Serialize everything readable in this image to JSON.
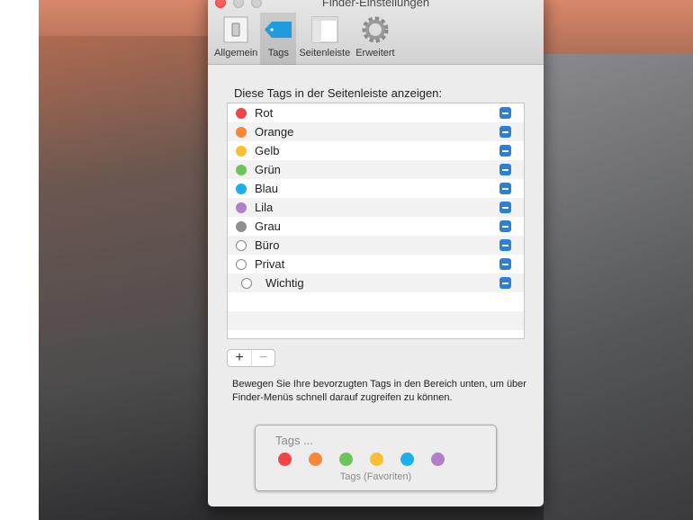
{
  "window": {
    "title": "Finder-Einstellungen"
  },
  "tabs": [
    {
      "label": "Allgemein"
    },
    {
      "label": "Tags",
      "active": true
    },
    {
      "label": "Seitenleiste"
    },
    {
      "label": "Erweitert"
    }
  ],
  "heading": "Diese Tags in der Seitenleiste anzeigen:",
  "tags": [
    {
      "label": "Rot",
      "color": "#f0464a",
      "checked": "mixed"
    },
    {
      "label": "Orange",
      "color": "#f5883a",
      "checked": "mixed"
    },
    {
      "label": "Gelb",
      "color": "#fbbf33",
      "checked": "mixed"
    },
    {
      "label": "Grün",
      "color": "#6ec35b",
      "checked": "mixed"
    },
    {
      "label": "Blau",
      "color": "#1ab0ec",
      "checked": "mixed"
    },
    {
      "label": "Lila",
      "color": "#b07fc8",
      "checked": "mixed"
    },
    {
      "label": "Grau",
      "color": "#8e8e93",
      "checked": "mixed"
    },
    {
      "label": "Büro",
      "color": null,
      "checked": "mixed"
    },
    {
      "label": "Privat",
      "color": null,
      "checked": "mixed"
    },
    {
      "label": "Wichtig",
      "color": null,
      "checked": "mixed",
      "indent": true
    }
  ],
  "buttons": {
    "add": "+",
    "remove": "−"
  },
  "help": "Bewegen Sie Ihre bevorzugten Tags in den Bereich unten, um über Finder-Menüs schnell darauf zugreifen zu können.",
  "favorites": {
    "placeholder": "Tags ...",
    "caption": "Tags (Favoriten)",
    "colors": [
      "#f0464a",
      "#f5883a",
      "#6ec35b",
      "#fbbf33",
      "#1ab0ec",
      "#b07fc8"
    ]
  }
}
